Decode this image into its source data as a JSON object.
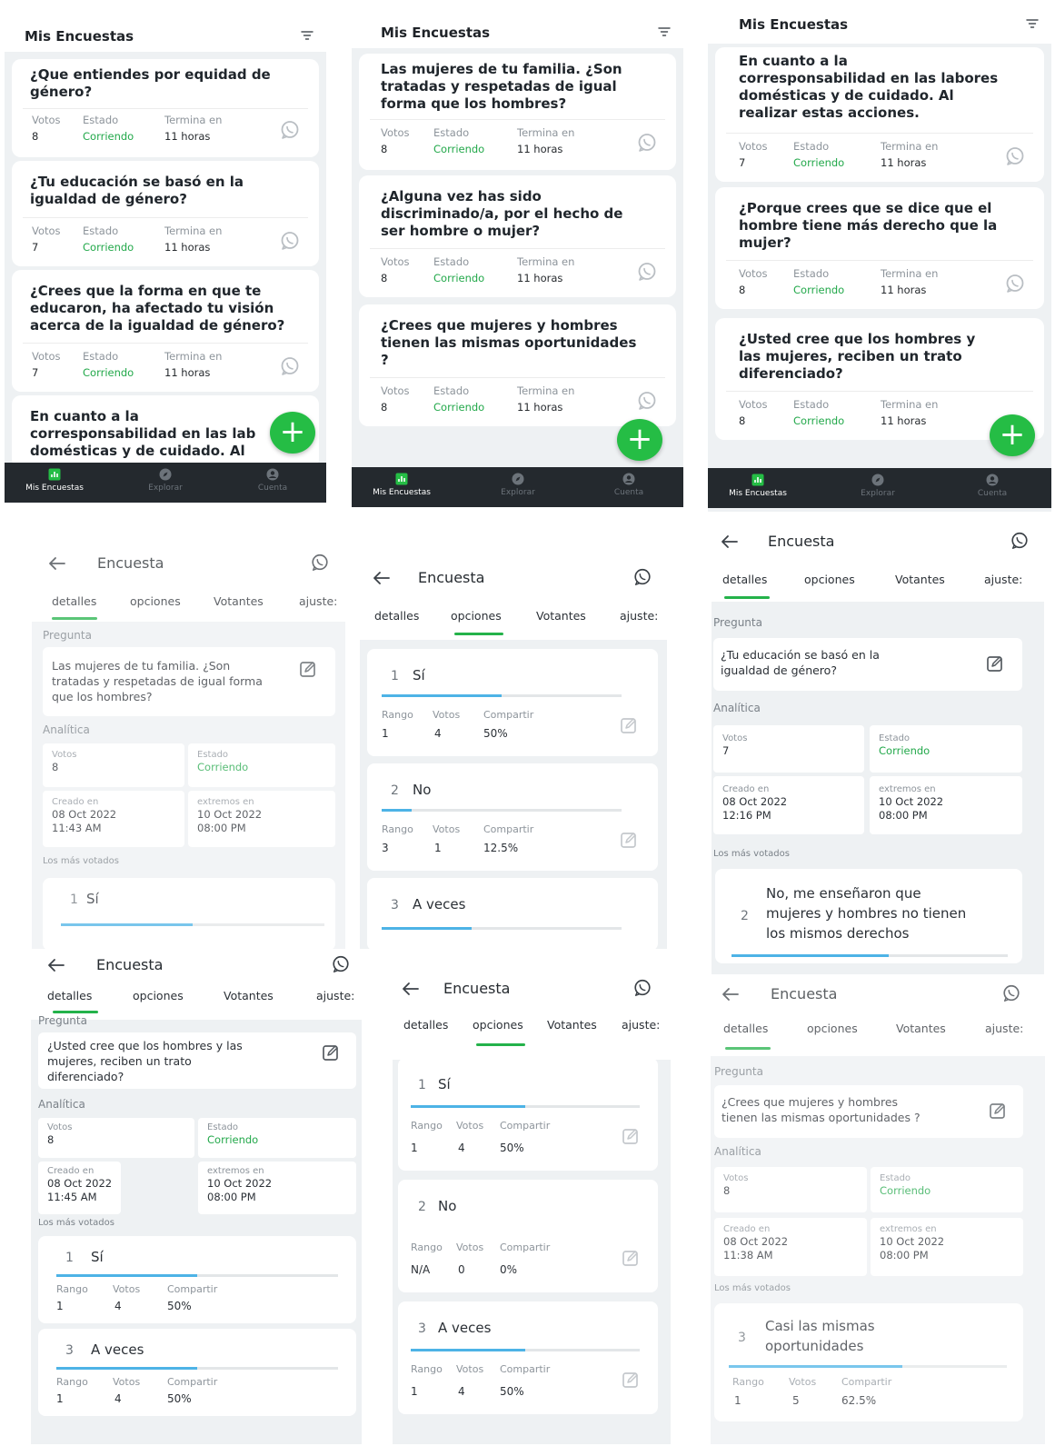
{
  "colors": {
    "accent_green": "#25bd45",
    "status_green": "#22a84a",
    "bar_blue": "#4db3e6",
    "nav_dark": "#24292e"
  },
  "list": {
    "title": "Mis Encuestas",
    "labels": {
      "votes": "Votos",
      "status": "Estado",
      "ends": "Termina en"
    },
    "status_value": "Corriendo",
    "ends_value": "11 horas",
    "fab": "+",
    "nav": {
      "home": "Mis Encuestas",
      "explore": "Explorar",
      "account": "Cuenta"
    },
    "screen1": [
      {
        "question": "¿Que entiendes por equidad de\ngénero?",
        "votes": "8"
      },
      {
        "question": "¿Tu educación se basó en la\nigualdad de género?",
        "votes": "7"
      },
      {
        "question": "¿Crees que la forma en que te\neducaron, ha afectado tu visión\nacerca de la igualdad de género?",
        "votes": "7"
      },
      {
        "question": "En cuanto a la\ncorresponsabilidad en las lab\ndomésticas y de cuidado. Al"
      }
    ],
    "screen2": [
      {
        "question": "Las mujeres de tu familia. ¿Son\ntratadas y respetadas de igual\nforma que los hombres?",
        "votes": "8"
      },
      {
        "question": "¿Alguna vez has sido\ndiscriminado/a, por el hecho de\nser hombre o  mujer?",
        "votes": "8"
      },
      {
        "question": "¿Crees que mujeres y hombres\ntienen las mismas oportunidades\n?",
        "votes": "8"
      }
    ],
    "screen3": [
      {
        "question": "En cuanto a la\ncorresponsabilidad en las labores\ndomésticas y de cuidado. Al\nrealizar estas acciones.",
        "votes": "7"
      },
      {
        "question": "¿Porque crees que se dice que el\nhombre tiene más derecho que la\nmujer?",
        "votes": "8"
      },
      {
        "question": "¿Usted cree que los hombres y\nlas mujeres, reciben un trato\ndiferenciado?",
        "votes": "8"
      }
    ]
  },
  "detail": {
    "title": "Encuesta",
    "tabs": {
      "details": "detalles",
      "options": "opciones",
      "voters": "Votantes",
      "settings": "ajuste:"
    },
    "section_question": "Pregunta",
    "section_analytics": "Analítica",
    "section_top": "Los más votados",
    "labels": {
      "votes": "Votos",
      "status": "Estado",
      "created": "Creado en",
      "ends": "extremos en",
      "range": "Rango",
      "share": "Compartir"
    },
    "status_value": "Corriendo",
    "end_date": "10 Oct 2022\n08:00 PM",
    "screenA": {
      "question": "Las mujeres de tu familia. ¿Son\ntratadas y respetadas de igual forma\nque los hombres?",
      "votes": "8",
      "created": "08 Oct 2022\n11:43 AM",
      "top": {
        "num": "1",
        "label": "Sí",
        "fill": 0.5
      }
    },
    "screenB": {
      "options": [
        {
          "num": "1",
          "label": "Sí",
          "range": "1",
          "votes": "4",
          "share": "50%",
          "fill": 0.5
        },
        {
          "num": "2",
          "label": "No",
          "range": "3",
          "votes": "1",
          "share": "12.5%",
          "fill": 0.125
        },
        {
          "num": "3",
          "label": "A veces",
          "fill": 0.375
        }
      ]
    },
    "screenC": {
      "question": "¿Tu educación se basó en la\nigualdad de género?",
      "votes": "7",
      "created": "08 Oct 2022\n12:16 PM",
      "top": {
        "num": "2",
        "label": "No, me enseñaron que\nmujeres y hombres no tienen\nlos mismos derechos",
        "fill": 0.57
      }
    },
    "screenD": {
      "question": "¿Usted cree que los hombres y las\nmujeres, reciben un trato\ndiferenciado?",
      "votes": "8",
      "created": "08 Oct 2022\n11:45 AM",
      "top": [
        {
          "num": "1",
          "label": "Sí",
          "range": "1",
          "votes": "4",
          "share": "50%",
          "fill": 0.5
        },
        {
          "num": "3",
          "label": "A veces",
          "range": "1",
          "votes": "4",
          "share": "50%",
          "fill": 0.5
        }
      ]
    },
    "screenE": {
      "options": [
        {
          "num": "1",
          "label": "Sí",
          "range": "1",
          "votes": "4",
          "share": "50%",
          "fill": 0.5
        },
        {
          "num": "2",
          "label": "No",
          "range": "N/A",
          "votes": "0",
          "share": "0%",
          "fill": 0
        },
        {
          "num": "3",
          "label": "A veces",
          "range": "1",
          "votes": "4",
          "share": "50%",
          "fill": 0.5
        }
      ]
    },
    "screenF": {
      "question": "¿Crees que mujeres y hombres\ntienen las mismas oportunidades ?",
      "votes": "8",
      "created": "08 Oct 2022\n11:38 AM",
      "top": {
        "num": "3",
        "label": "Casi las mismas\noportunidades",
        "range": "1",
        "votes": "5",
        "share": "62.5%",
        "fill": 0.625
      }
    }
  }
}
